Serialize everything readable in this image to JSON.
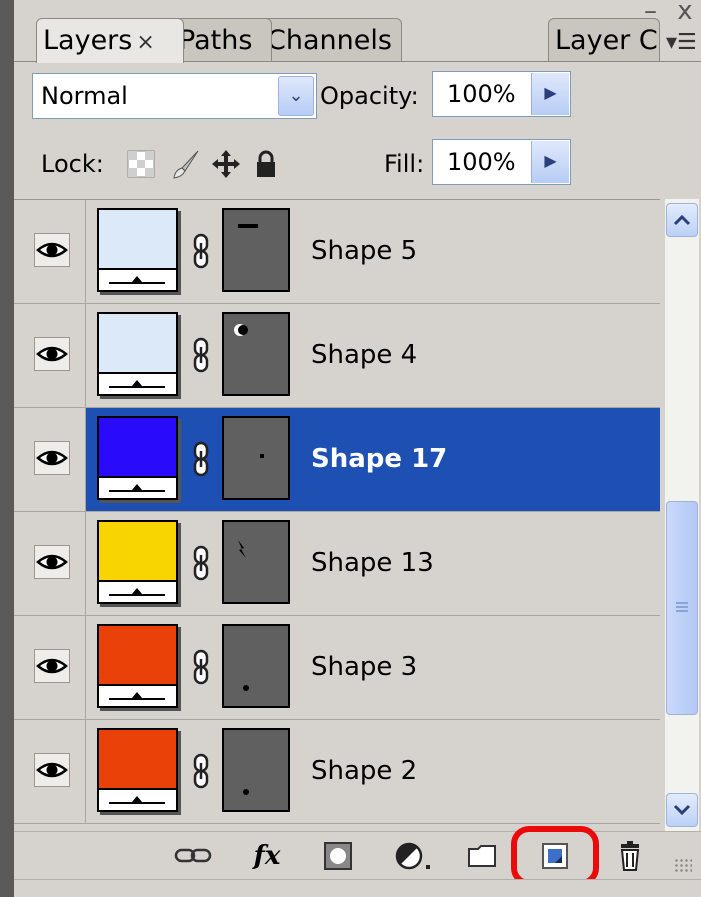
{
  "panel": {
    "tabs": [
      {
        "label": "Layers",
        "close": "×",
        "active": true
      },
      {
        "label": "Paths",
        "active": false
      },
      {
        "label": "Channels",
        "active": false
      },
      {
        "label": "Layer Comps",
        "active": false
      }
    ],
    "window_controls": "– x",
    "menu_glyph": "▾☰"
  },
  "controls": {
    "blend_mode": "Normal",
    "opacity_label": "Opacity:",
    "opacity_value": "100%",
    "lock_label": "Lock:",
    "fill_label": "Fill:",
    "fill_value": "100%",
    "dropdown_glyph": "⌄",
    "stepper_glyph": "▶"
  },
  "layers": [
    {
      "name": "Shape 5",
      "color": "#dbe9f8",
      "selected": false,
      "mask_icon": "dash"
    },
    {
      "name": "Shape 4",
      "color": "#dbe9f8",
      "selected": false,
      "mask_icon": "moon"
    },
    {
      "name": "Shape 17",
      "color": "#2a0afa",
      "selected": true,
      "mask_icon": "tiny-dot"
    },
    {
      "name": "Shape 13",
      "color": "#f8d400",
      "selected": false,
      "mask_icon": "bolt"
    },
    {
      "name": "Shape 3",
      "color": "#e94108",
      "selected": false,
      "mask_icon": "dot"
    },
    {
      "name": "Shape 2",
      "color": "#e94108",
      "selected": false,
      "mask_icon": "dot"
    }
  ],
  "toolbar": {
    "link": "link-layers-icon",
    "fx": "fx",
    "mask": "add-mask-icon",
    "adjustment": "adjustment-layer-icon",
    "group": "new-group-icon",
    "new_layer": "new-layer-icon",
    "delete": "trash-icon",
    "highlight_color": "#ea0a0a"
  },
  "colors": {
    "panel_bg": "#d6d3ce",
    "selection": "#1e4fb3",
    "mask_bg": "#606060"
  }
}
